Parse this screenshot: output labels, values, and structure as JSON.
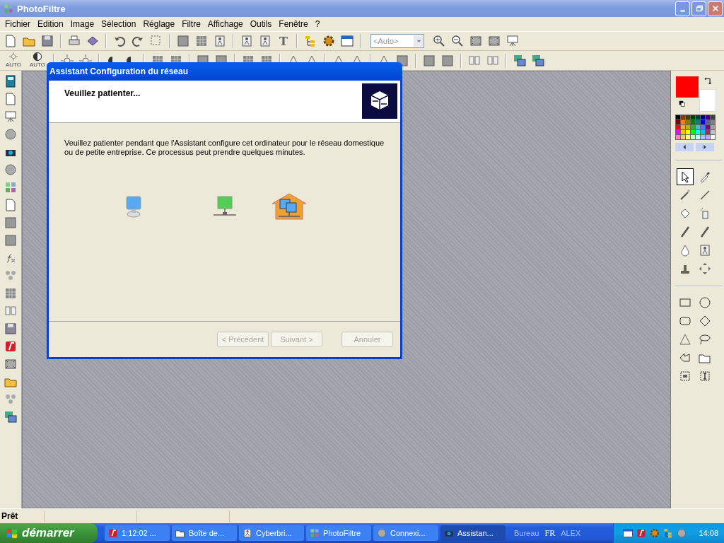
{
  "window": {
    "title": "PhotoFiltre"
  },
  "menu": [
    "Fichier",
    "Edition",
    "Image",
    "Sélection",
    "Réglage",
    "Filtre",
    "Affichage",
    "Outils",
    "Fenêtre",
    "?"
  ],
  "toolbar": {
    "text_glyph": "T",
    "zoom_select": {
      "value": "<Auto>"
    }
  },
  "toolbar2": {
    "auto_labels": [
      "AUTO",
      "AUTO"
    ]
  },
  "dialog": {
    "title": "Assistant Configuration du réseau",
    "heading": "Veuillez patienter...",
    "message": "Veuillez patienter pendant que l'Assistant configure cet ordinateur pour le réseau domestique ou de petite entreprise. Ce processus peut prendre quelques minutes.",
    "buttons": [
      {
        "label": "< Précédent",
        "disabled": true
      },
      {
        "label": "Suivant >",
        "disabled": true
      },
      {
        "label": "Annuler",
        "disabled": true
      }
    ]
  },
  "colors": {
    "swatches": [
      {
        "kind": "foreground",
        "color": "#ff0000"
      },
      {
        "kind": "background",
        "color": "#ffffff"
      }
    ],
    "palette": [
      {
        "color": "#000000"
      },
      {
        "color": "#804000"
      },
      {
        "color": "#404000"
      },
      {
        "color": "#004000"
      },
      {
        "color": "#004040"
      },
      {
        "color": "#000080"
      },
      {
        "color": "#400080"
      },
      {
        "color": "#404040"
      },
      {
        "color": "#800000"
      },
      {
        "color": "#ff8000"
      },
      {
        "color": "#808000"
      },
      {
        "color": "#008000"
      },
      {
        "color": "#008080"
      },
      {
        "color": "#0000ff"
      },
      {
        "color": "#606090"
      },
      {
        "color": "#808080"
      },
      {
        "color": "#ff0000"
      },
      {
        "color": "#ffa040"
      },
      {
        "color": "#a0c000"
      },
      {
        "color": "#40a040"
      },
      {
        "color": "#40c0c0"
      },
      {
        "color": "#4080ff"
      },
      {
        "color": "#800080"
      },
      {
        "color": "#a0a0a0"
      },
      {
        "color": "#ff00ff"
      },
      {
        "color": "#ffc000"
      },
      {
        "color": "#ffff00"
      },
      {
        "color": "#00ff00"
      },
      {
        "color": "#00ffff"
      },
      {
        "color": "#00c0ff"
      },
      {
        "color": "#a03060"
      },
      {
        "color": "#c0c0c0"
      },
      {
        "color": "#ff80c0"
      },
      {
        "color": "#ffc080"
      },
      {
        "color": "#ffff80"
      },
      {
        "color": "#c0ffc0"
      },
      {
        "color": "#c0ffff"
      },
      {
        "color": "#a0c0ff"
      },
      {
        "color": "#c0a0ff"
      },
      {
        "color": "#ffffff"
      }
    ]
  },
  "tools": [
    {
      "selected": true
    },
    {
      "selected": false
    },
    {
      "selected": false
    },
    {
      "selected": false
    },
    {
      "selected": false
    },
    {
      "selected": false
    },
    {
      "selected": false
    },
    {
      "selected": false
    },
    {
      "selected": false
    },
    {
      "selected": false
    },
    {
      "selected": false
    },
    {
      "selected": false
    }
  ],
  "status_bar": {
    "text": "Prêt"
  },
  "taskbar": {
    "start": "démarrer",
    "tasks": [
      {
        "label": "1:12:02 ...",
        "selected": false
      },
      {
        "label": "Boîte de...",
        "selected": false
      },
      {
        "label": "Cyberbri...",
        "selected": false
      },
      {
        "label": "PhotoFiltre",
        "selected": false
      },
      {
        "label": "Connexi...",
        "selected": false
      },
      {
        "label": "Assistan...",
        "selected": true
      }
    ],
    "toolbars": [
      {
        "label": "Bureau"
      },
      {
        "label": "FR"
      },
      {
        "label": "ALEX"
      }
    ],
    "clock": "14:08"
  }
}
